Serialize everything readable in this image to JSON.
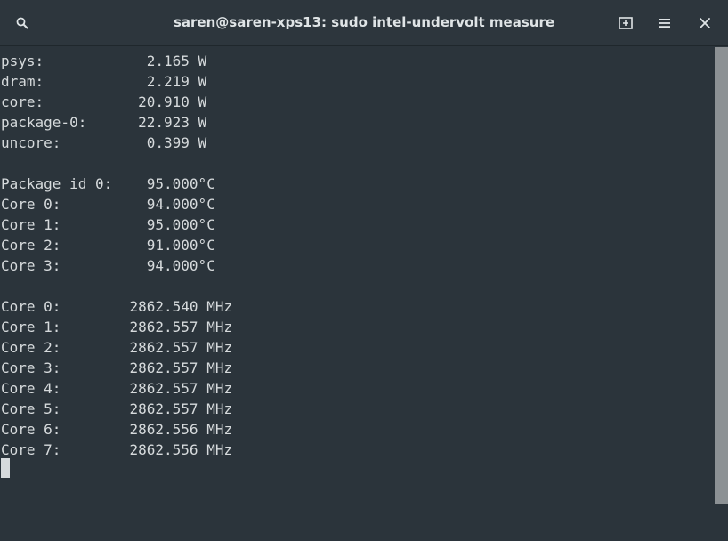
{
  "window": {
    "title": "saren@saren-xps13: sudo intel-undervolt measure"
  },
  "icons": {
    "search": "search-icon",
    "new_tab": "new-tab-icon",
    "menu": "hamburger-menu-icon",
    "close": "close-icon"
  },
  "colors": {
    "background": "#2b343b",
    "text": "#d6dadc",
    "title_text": "#dfe4e6",
    "scroll_thumb": "#8c9194"
  },
  "terminal": {
    "lines": [
      "psys:            2.165 W",
      "dram:            2.219 W",
      "core:           20.910 W",
      "package-0:      22.923 W",
      "uncore:          0.399 W",
      "",
      "Package id 0:    95.000°C",
      "Core 0:          94.000°C",
      "Core 1:          95.000°C",
      "Core 2:          91.000°C",
      "Core 3:          94.000°C",
      "",
      "Core 0:        2862.540 MHz",
      "Core 1:        2862.557 MHz",
      "Core 2:        2862.557 MHz",
      "Core 3:        2862.557 MHz",
      "Core 4:        2862.557 MHz",
      "Core 5:        2862.557 MHz",
      "Core 6:        2862.556 MHz",
      "Core 7:        2862.556 MHz"
    ]
  }
}
